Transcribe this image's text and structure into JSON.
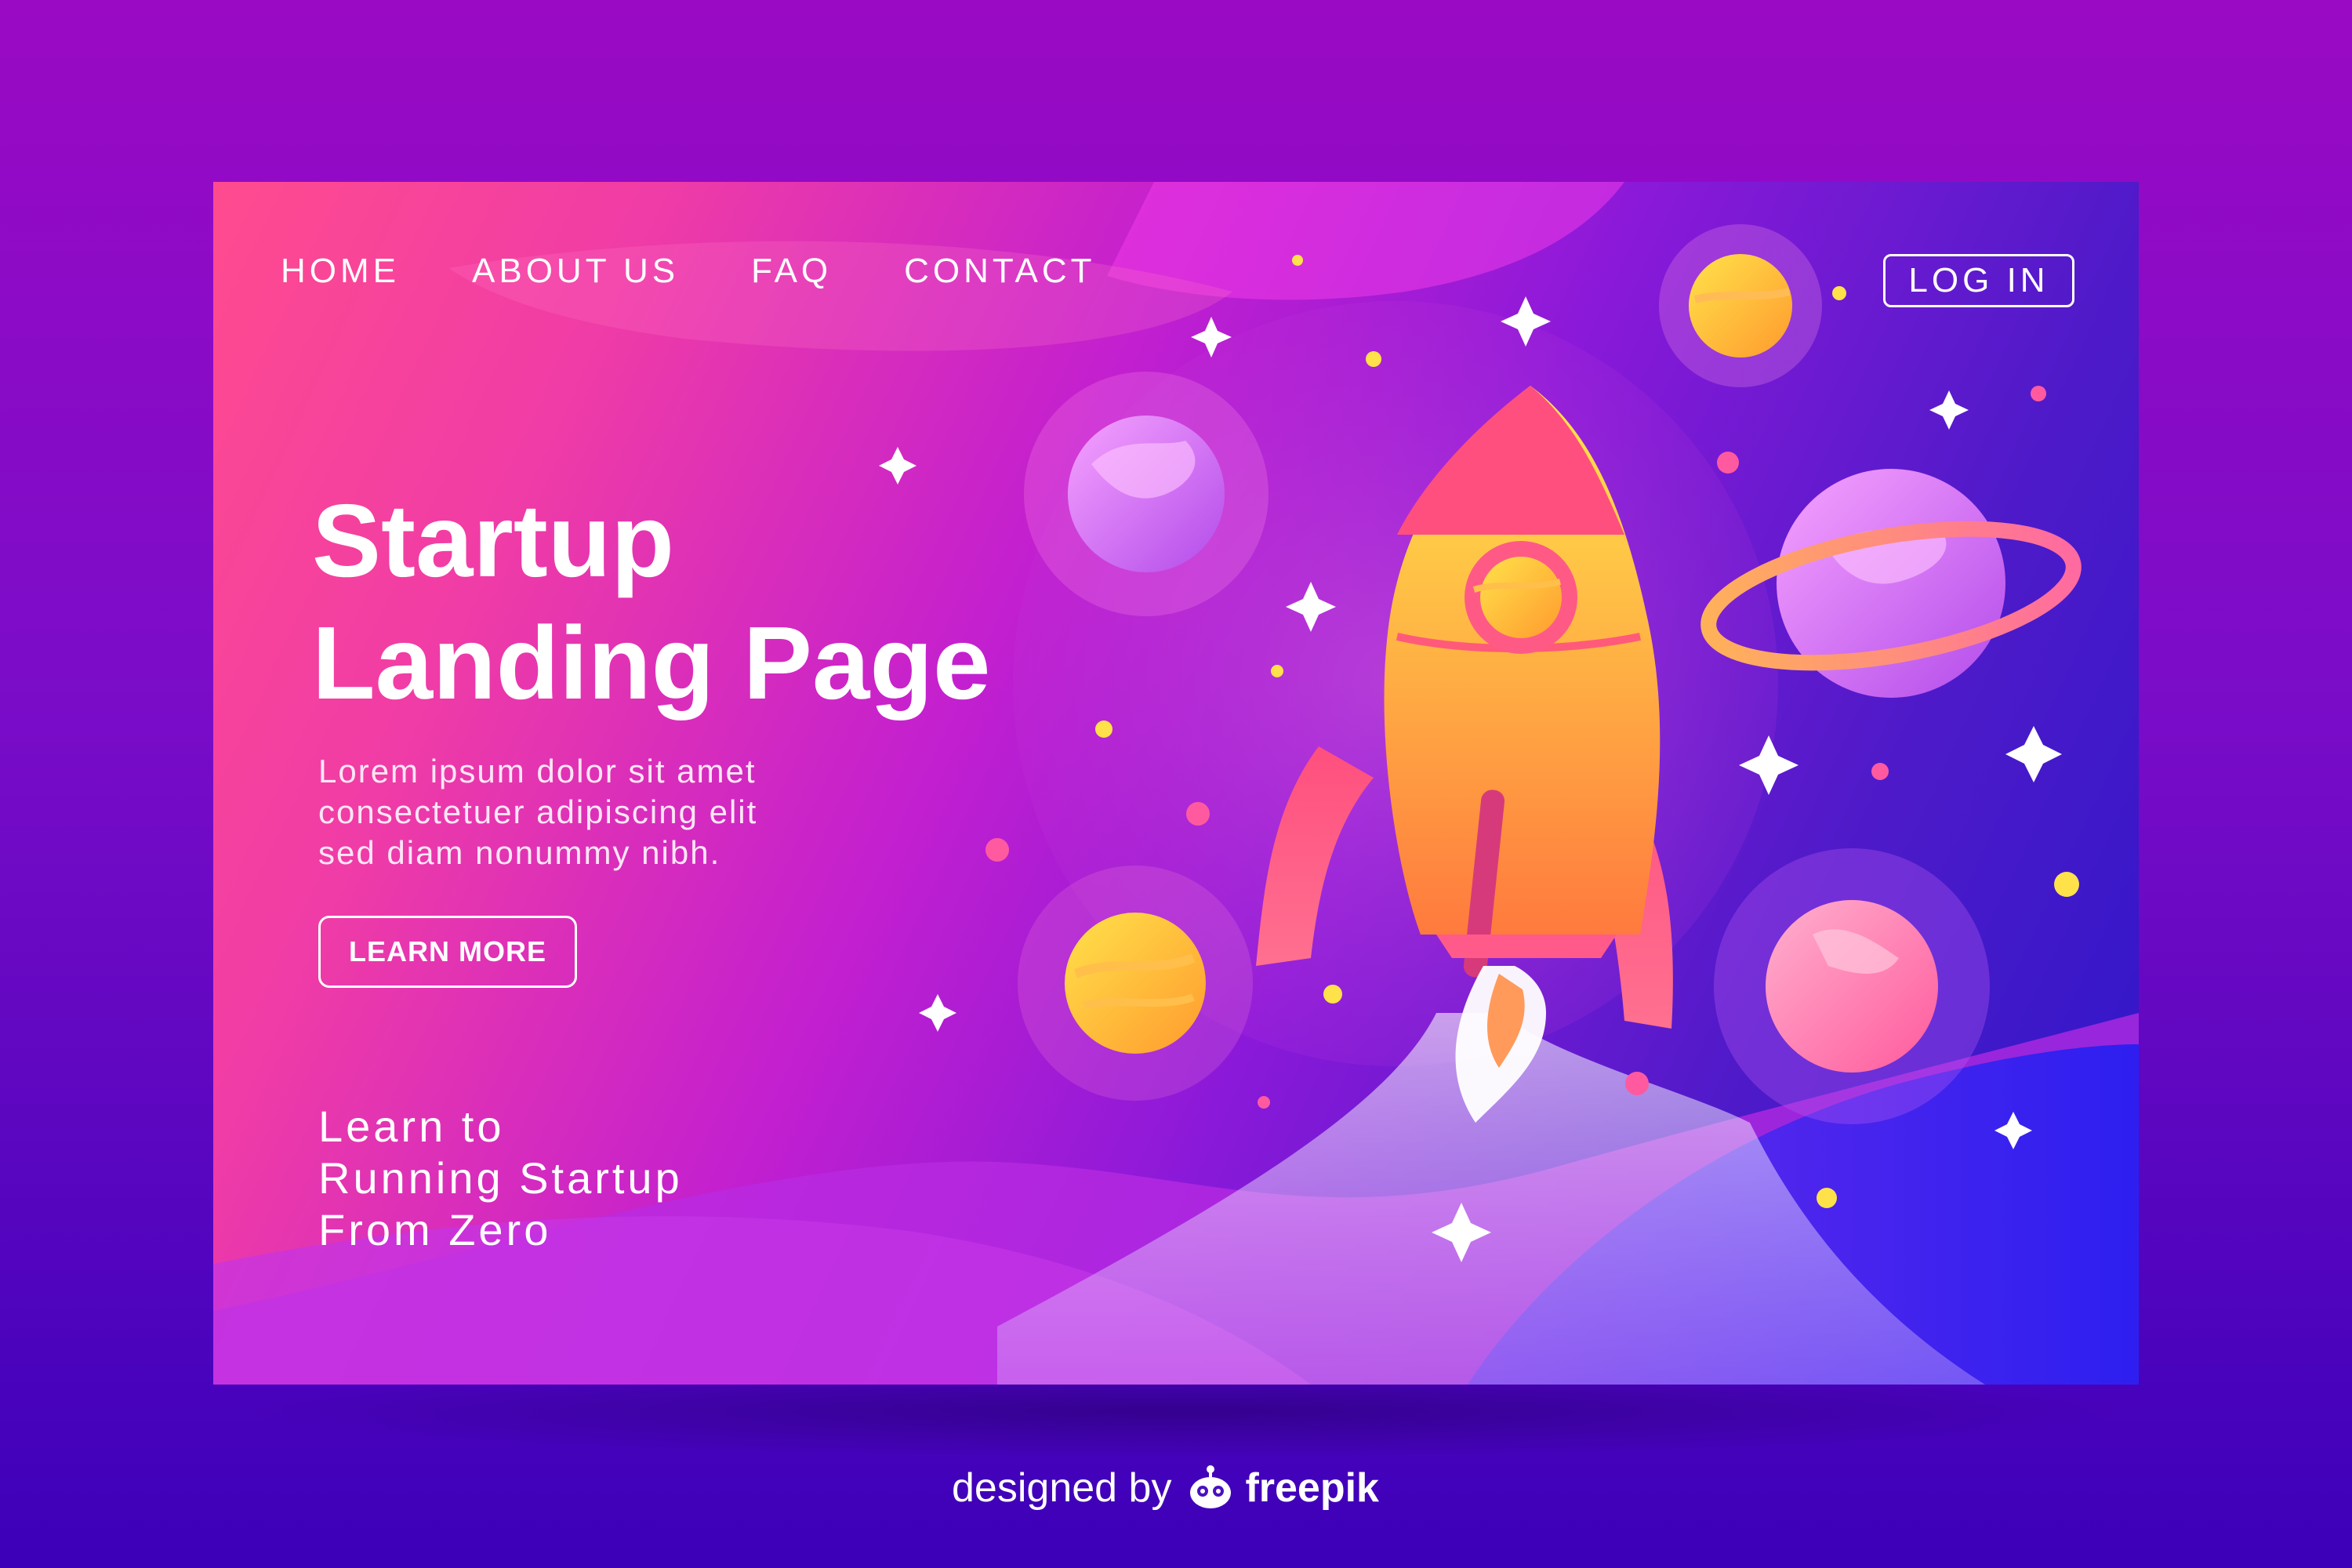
{
  "nav": {
    "items": [
      {
        "label": "HOME"
      },
      {
        "label": "ABOUT US"
      },
      {
        "label": "FAQ"
      },
      {
        "label": "CONTACT"
      }
    ],
    "login_label": "LOG IN"
  },
  "hero": {
    "title_line1": "Startup",
    "title_line2": "Landing Page",
    "desc_line1": "Lorem ipsum dolor sit amet",
    "desc_line2": "consectetuer adipiscing elit",
    "desc_line3": "sed diam nonummy nibh.",
    "cta_label": "LEARN MORE",
    "tagline_line1": "Learn to",
    "tagline_line2": "Running Startup",
    "tagline_line3": "From Zero"
  },
  "credit": {
    "prefix": "designed by",
    "brand": "freepik",
    "icon": "freepik-logo-icon"
  },
  "colors": {
    "card_start": "#ff4b8e",
    "card_mid": "#c21fd0",
    "card_end": "#2a17c9",
    "rocket_body": "#ffb23f",
    "rocket_fins": "#ff4f86",
    "star": "#ffffff",
    "dot_yellow": "#ffe14a",
    "dot_pink": "#ff5aa0"
  },
  "icons": [
    "rocket-icon",
    "planet-icon",
    "ringed-planet-icon",
    "star-icon"
  ]
}
